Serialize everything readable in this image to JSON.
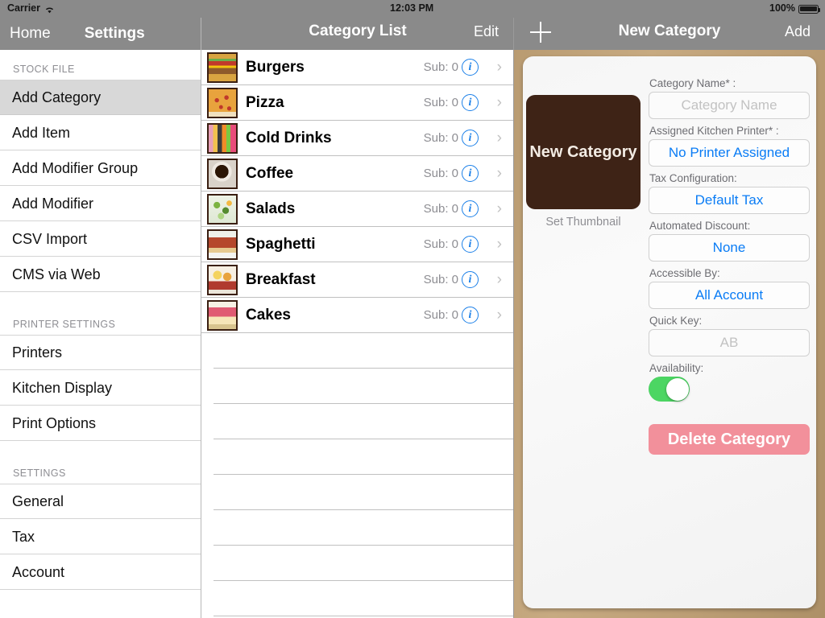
{
  "statusbar": {
    "carrier": "Carrier",
    "time": "12:03 PM",
    "battery_percent": "100%",
    "wifi_icon": "wifi-icon",
    "battery_icon": "battery-icon"
  },
  "sidebar": {
    "nav": {
      "back_label": "Home",
      "title": "Settings"
    },
    "sections": [
      {
        "header": "STOCK FILE",
        "items": [
          {
            "label": "Add Category",
            "selected": true
          },
          {
            "label": "Add Item",
            "selected": false
          },
          {
            "label": "Add Modifier Group",
            "selected": false
          },
          {
            "label": "Add Modifier",
            "selected": false
          },
          {
            "label": "CSV Import",
            "selected": false
          },
          {
            "label": "CMS via Web",
            "selected": false
          }
        ]
      },
      {
        "header": "PRINTER SETTINGS",
        "items": [
          {
            "label": "Printers",
            "selected": false
          },
          {
            "label": "Kitchen Display",
            "selected": false
          },
          {
            "label": "Print Options",
            "selected": false
          }
        ]
      },
      {
        "header": "SETTINGS",
        "items": [
          {
            "label": "General",
            "selected": false
          },
          {
            "label": "Tax",
            "selected": false
          },
          {
            "label": "Account",
            "selected": false
          }
        ]
      }
    ]
  },
  "middle": {
    "nav": {
      "title": "Category List",
      "edit_label": "Edit"
    },
    "sub_prefix": "Sub: ",
    "info_glyph": "i",
    "chevron_glyph": "›",
    "categories": [
      {
        "name": "Burgers",
        "sub_count": "0",
        "thumb": "t-burger"
      },
      {
        "name": "Pizza",
        "sub_count": "0",
        "thumb": "t-pizza"
      },
      {
        "name": "Cold Drinks",
        "sub_count": "0",
        "thumb": "t-drinks"
      },
      {
        "name": "Coffee",
        "sub_count": "0",
        "thumb": "t-coffee"
      },
      {
        "name": "Salads",
        "sub_count": "0",
        "thumb": "t-salads"
      },
      {
        "name": "Spaghetti",
        "sub_count": "0",
        "thumb": "t-spaghetti"
      },
      {
        "name": "Breakfast",
        "sub_count": "0",
        "thumb": "t-breakfast"
      },
      {
        "name": "Cakes",
        "sub_count": "0",
        "thumb": "t-cakes"
      }
    ],
    "empty_row_count": 8
  },
  "detail": {
    "nav": {
      "add_icon": "plus-icon",
      "title": "New Category",
      "add_label": "Add"
    },
    "thumbnail": {
      "text": "New Category",
      "caption": "Set Thumbnail",
      "color": "#3e2316"
    },
    "fields": [
      {
        "label": "Category Name* :",
        "value": "Category Name",
        "style": "placeholder",
        "name": "category-name-input"
      },
      {
        "label": "Assigned Kitchen Printer* :",
        "value": "No Printer Assigned",
        "style": "blue",
        "name": "kitchen-printer-select"
      },
      {
        "label": "Tax Configuration:",
        "value": "Default Tax",
        "style": "blue",
        "name": "tax-configuration-select"
      },
      {
        "label": "Automated Discount:",
        "value": "None",
        "style": "blue",
        "name": "automated-discount-select"
      },
      {
        "label": "Accessible By:",
        "value": "All Account",
        "style": "blue",
        "name": "accessible-by-select"
      },
      {
        "label": "Quick Key:",
        "value": "AB",
        "style": "placeholder",
        "name": "quick-key-input"
      }
    ],
    "availability": {
      "label": "Availability:",
      "on": true
    },
    "delete_label": "Delete Category",
    "colors": {
      "accent_blue": "#0a7cf5",
      "toggle_green": "#4cd663",
      "delete_pink": "#f2909b",
      "navbar_gray": "#8a8a8a"
    }
  }
}
